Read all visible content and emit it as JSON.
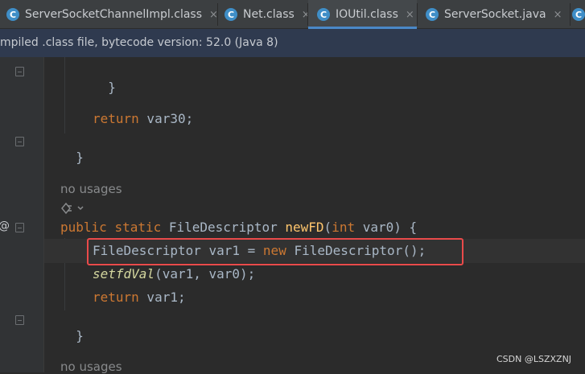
{
  "tabs": [
    {
      "label": "ServerSocketChannelImpl.class",
      "icon": "class-file-icon",
      "active": false
    },
    {
      "label": "Net.class",
      "icon": "class-file-icon",
      "active": false
    },
    {
      "label": "IOUtil.class",
      "icon": "class-file-icon",
      "active": true
    },
    {
      "label": "ServerSocket.java",
      "icon": "class-file-icon",
      "active": false
    }
  ],
  "tab_icon_letter": "C",
  "tab_close_glyph": "×",
  "banner": "mpiled .class file, bytecode version: 52.0 (Java 8)",
  "code": {
    "close_brace": "}",
    "return_kw": "return",
    "return_var30": " var30;",
    "hint_no_usages_1": "no usages",
    "hint_no_usages_2": "no usages",
    "sig_public": "public",
    "sig_static": "static",
    "sig_type": "FileDescriptor",
    "sig_name": "newFD",
    "sig_int": "int",
    "sig_params_open": "(",
    "sig_param": " var0) {",
    "line1_type": "FileDescriptor var1 = ",
    "line1_new": "new",
    "line1_rest": " FileDescriptor();",
    "line2_call": "setfdVal",
    "line2_args": "(var1, var0);",
    "return_var1": " var1;"
  },
  "gutter_marker": "@",
  "watermark": "CSDN @LSZXZNJ",
  "colors": {
    "background": "#2b2b2b",
    "keyword": "#cc7832",
    "function": "#ffc66d",
    "highlight_box": "#e94a4a",
    "active_tab_underline": "#4a88c7"
  }
}
